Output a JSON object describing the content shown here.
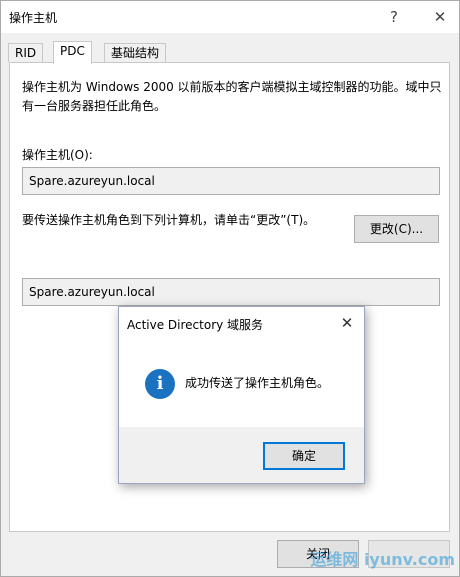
{
  "window": {
    "title": "操作主机",
    "help_glyph": "?",
    "close_glyph": "✕"
  },
  "tabs": [
    {
      "label": "RID"
    },
    {
      "label": "PDC"
    },
    {
      "label": "基础结构"
    }
  ],
  "panel": {
    "description": "操作主机为 Windows 2000 以前版本的客户端模拟主域控制器的功能。域中只有一台服务器担任此角色。",
    "master_label": "操作主机(O):",
    "master_value": "Spare.azureyun.local",
    "transfer_text": "要传送操作主机角色到下列计算机，请单击“更改”(T)。",
    "change_button": "更改(C)...",
    "target_value": "Spare.azureyun.local"
  },
  "footer": {
    "close_button": "关闭"
  },
  "dialog": {
    "title": "Active Directory 域服务",
    "close_glyph": "✕",
    "message": "成功传送了操作主机角色。",
    "icon_glyph": "i",
    "ok_button": "确定"
  },
  "watermark": {
    "text": "运维网 iyunv.com"
  },
  "colors": {
    "accent": "#0078d7",
    "info_icon": "#1b72c0"
  }
}
